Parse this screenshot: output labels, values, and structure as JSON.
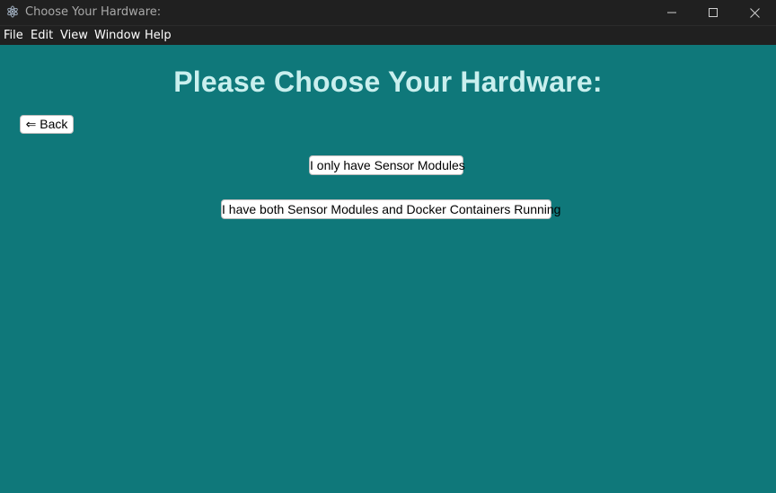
{
  "window": {
    "title": "Choose Your Hardware:",
    "app_icon": "electron-icon",
    "controls": {
      "minimize_icon": "minimize-icon",
      "maximize_icon": "maximize-icon",
      "close_icon": "close-icon"
    }
  },
  "menubar": {
    "items": [
      {
        "label": "File"
      },
      {
        "label": "Edit"
      },
      {
        "label": "View"
      },
      {
        "label": "Window"
      },
      {
        "label": "Help"
      }
    ]
  },
  "main": {
    "heading": "Please Choose Your Hardware:",
    "back_label": "⇐ Back",
    "options": [
      {
        "label": "I only have Sensor Modules"
      },
      {
        "label": "I have both Sensor Modules and Docker Containers Running"
      }
    ]
  },
  "colors": {
    "background": "#0f787a",
    "heading": "#c9efee",
    "titlebar": "#202020"
  }
}
